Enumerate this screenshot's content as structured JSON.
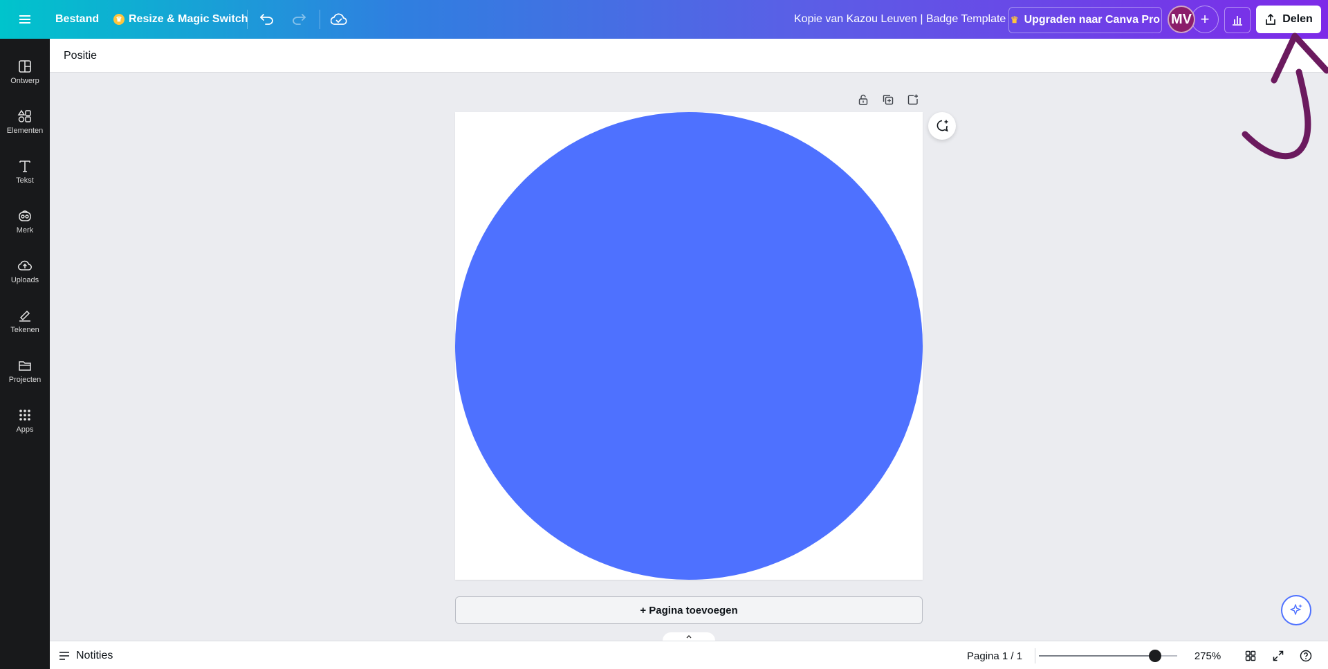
{
  "topbar": {
    "file_menu": "Bestand",
    "resize_label": "Resize & Magic Switch",
    "document_title": "Kopie van Kazou Leuven | Badge Template",
    "upgrade_label": "Upgraden naar Canva Pro",
    "avatar_initials": "MV",
    "share_label": "Delen"
  },
  "sidebar": {
    "items": [
      {
        "label": "Ontwerp",
        "icon": "design-icon"
      },
      {
        "label": "Elementen",
        "icon": "elements-icon"
      },
      {
        "label": "Tekst",
        "icon": "text-icon"
      },
      {
        "label": "Merk",
        "icon": "brand-icon"
      },
      {
        "label": "Uploads",
        "icon": "upload-icon"
      },
      {
        "label": "Tekenen",
        "icon": "draw-icon"
      },
      {
        "label": "Projecten",
        "icon": "folder-icon"
      },
      {
        "label": "Apps",
        "icon": "apps-icon"
      }
    ]
  },
  "context_toolbar": {
    "position_label": "Positie"
  },
  "canvas": {
    "circle_color": "#4e71ff",
    "add_page_label": "+ Pagina toevoegen"
  },
  "bottombar": {
    "notes_label": "Notities",
    "page_indicator": "Pagina 1 / 1",
    "zoom_level": "275%",
    "zoom_fraction": 0.84
  },
  "colors": {
    "accent": "#4e71ff",
    "annotation_arrow": "#6b1a5e",
    "avatar_bg": "#8b1d6b"
  }
}
